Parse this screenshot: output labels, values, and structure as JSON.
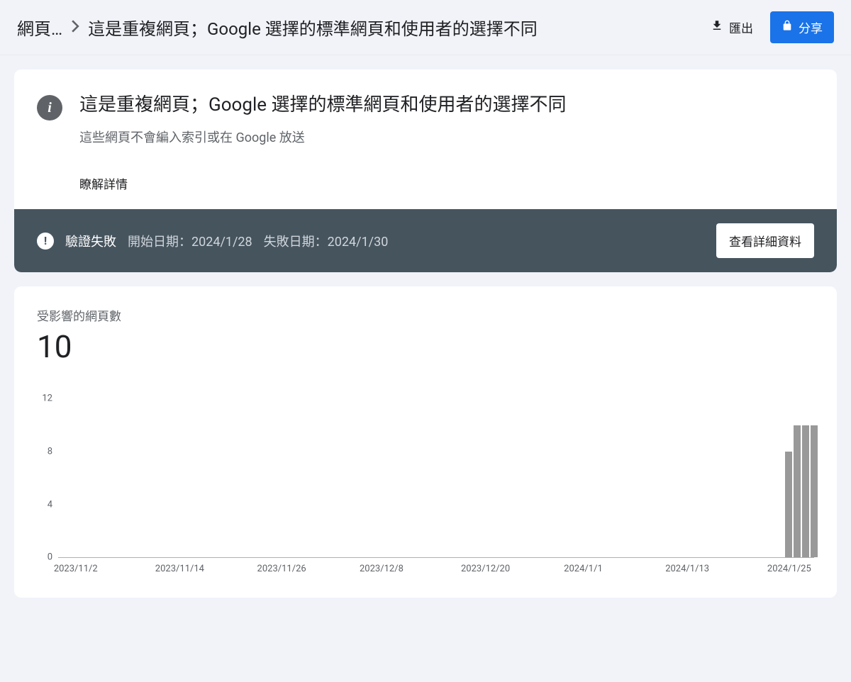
{
  "breadcrumb": {
    "root": "網頁…",
    "current": "這是重複網頁；Google 選擇的標準網頁和使用者的選擇不同"
  },
  "actions": {
    "export_label": "匯出",
    "share_label": "分享"
  },
  "issue_card": {
    "title": "這是重複網頁；Google 選擇的標準網頁和使用者的選擇不同",
    "subtitle": "這些網頁不會編入索引或在 Google 放送",
    "learn_more": "瞭解詳情"
  },
  "validation": {
    "label": "驗證失敗",
    "start_prefix": "開始日期：",
    "start_date": "2024/1/28",
    "fail_prefix": "失敗日期：",
    "fail_date": "2024/1/30",
    "view_details": "查看詳細資料"
  },
  "stats": {
    "label": "受影響的網頁數",
    "value": "10"
  },
  "chart_data": {
    "type": "bar",
    "title": "",
    "xlabel": "",
    "ylabel": "",
    "ylim": [
      0,
      12
    ],
    "y_ticks": [
      0,
      4,
      8,
      12
    ],
    "x_tick_labels": [
      "2023/11/2",
      "2023/11/14",
      "2023/11/26",
      "2023/12/8",
      "2023/12/20",
      "2024/1/1",
      "2024/1/13",
      "2024/1/25"
    ],
    "categories": [
      "2023/11/2",
      "2023/11/3",
      "2023/11/4",
      "2023/11/5",
      "2023/11/6",
      "2023/11/7",
      "2023/11/8",
      "2023/11/9",
      "2023/11/10",
      "2023/11/11",
      "2023/11/12",
      "2023/11/13",
      "2023/11/14",
      "2023/11/15",
      "2023/11/16",
      "2023/11/17",
      "2023/11/18",
      "2023/11/19",
      "2023/11/20",
      "2023/11/21",
      "2023/11/22",
      "2023/11/23",
      "2023/11/24",
      "2023/11/25",
      "2023/11/26",
      "2023/11/27",
      "2023/11/28",
      "2023/11/29",
      "2023/11/30",
      "2023/12/1",
      "2023/12/2",
      "2023/12/3",
      "2023/12/4",
      "2023/12/5",
      "2023/12/6",
      "2023/12/7",
      "2023/12/8",
      "2023/12/9",
      "2023/12/10",
      "2023/12/11",
      "2023/12/12",
      "2023/12/13",
      "2023/12/14",
      "2023/12/15",
      "2023/12/16",
      "2023/12/17",
      "2023/12/18",
      "2023/12/19",
      "2023/12/20",
      "2023/12/21",
      "2023/12/22",
      "2023/12/23",
      "2023/12/24",
      "2023/12/25",
      "2023/12/26",
      "2023/12/27",
      "2023/12/28",
      "2023/12/29",
      "2023/12/30",
      "2023/12/31",
      "2024/1/1",
      "2024/1/2",
      "2024/1/3",
      "2024/1/4",
      "2024/1/5",
      "2024/1/6",
      "2024/1/7",
      "2024/1/8",
      "2024/1/9",
      "2024/1/10",
      "2024/1/11",
      "2024/1/12",
      "2024/1/13",
      "2024/1/14",
      "2024/1/15",
      "2024/1/16",
      "2024/1/17",
      "2024/1/18",
      "2024/1/19",
      "2024/1/20",
      "2024/1/21",
      "2024/1/22",
      "2024/1/23",
      "2024/1/24",
      "2024/1/25",
      "2024/1/26",
      "2024/1/27",
      "2024/1/28",
      "2024/1/29",
      "2024/1/30"
    ],
    "values": [
      0,
      0,
      0,
      0,
      0,
      0,
      0,
      0,
      0,
      0,
      0,
      0,
      0,
      0,
      0,
      0,
      0,
      0,
      0,
      0,
      0,
      0,
      0,
      0,
      0,
      0,
      0,
      0,
      0,
      0,
      0,
      0,
      0,
      0,
      0,
      0,
      0,
      0,
      0,
      0,
      0,
      0,
      0,
      0,
      0,
      0,
      0,
      0,
      0,
      0,
      0,
      0,
      0,
      0,
      0,
      0,
      0,
      0,
      0,
      0,
      0,
      0,
      0,
      0,
      0,
      0,
      0,
      0,
      0,
      0,
      0,
      0,
      0,
      0,
      0,
      0,
      0,
      0,
      0,
      0,
      0,
      0,
      0,
      0,
      0,
      0,
      8,
      10,
      10,
      10
    ]
  }
}
